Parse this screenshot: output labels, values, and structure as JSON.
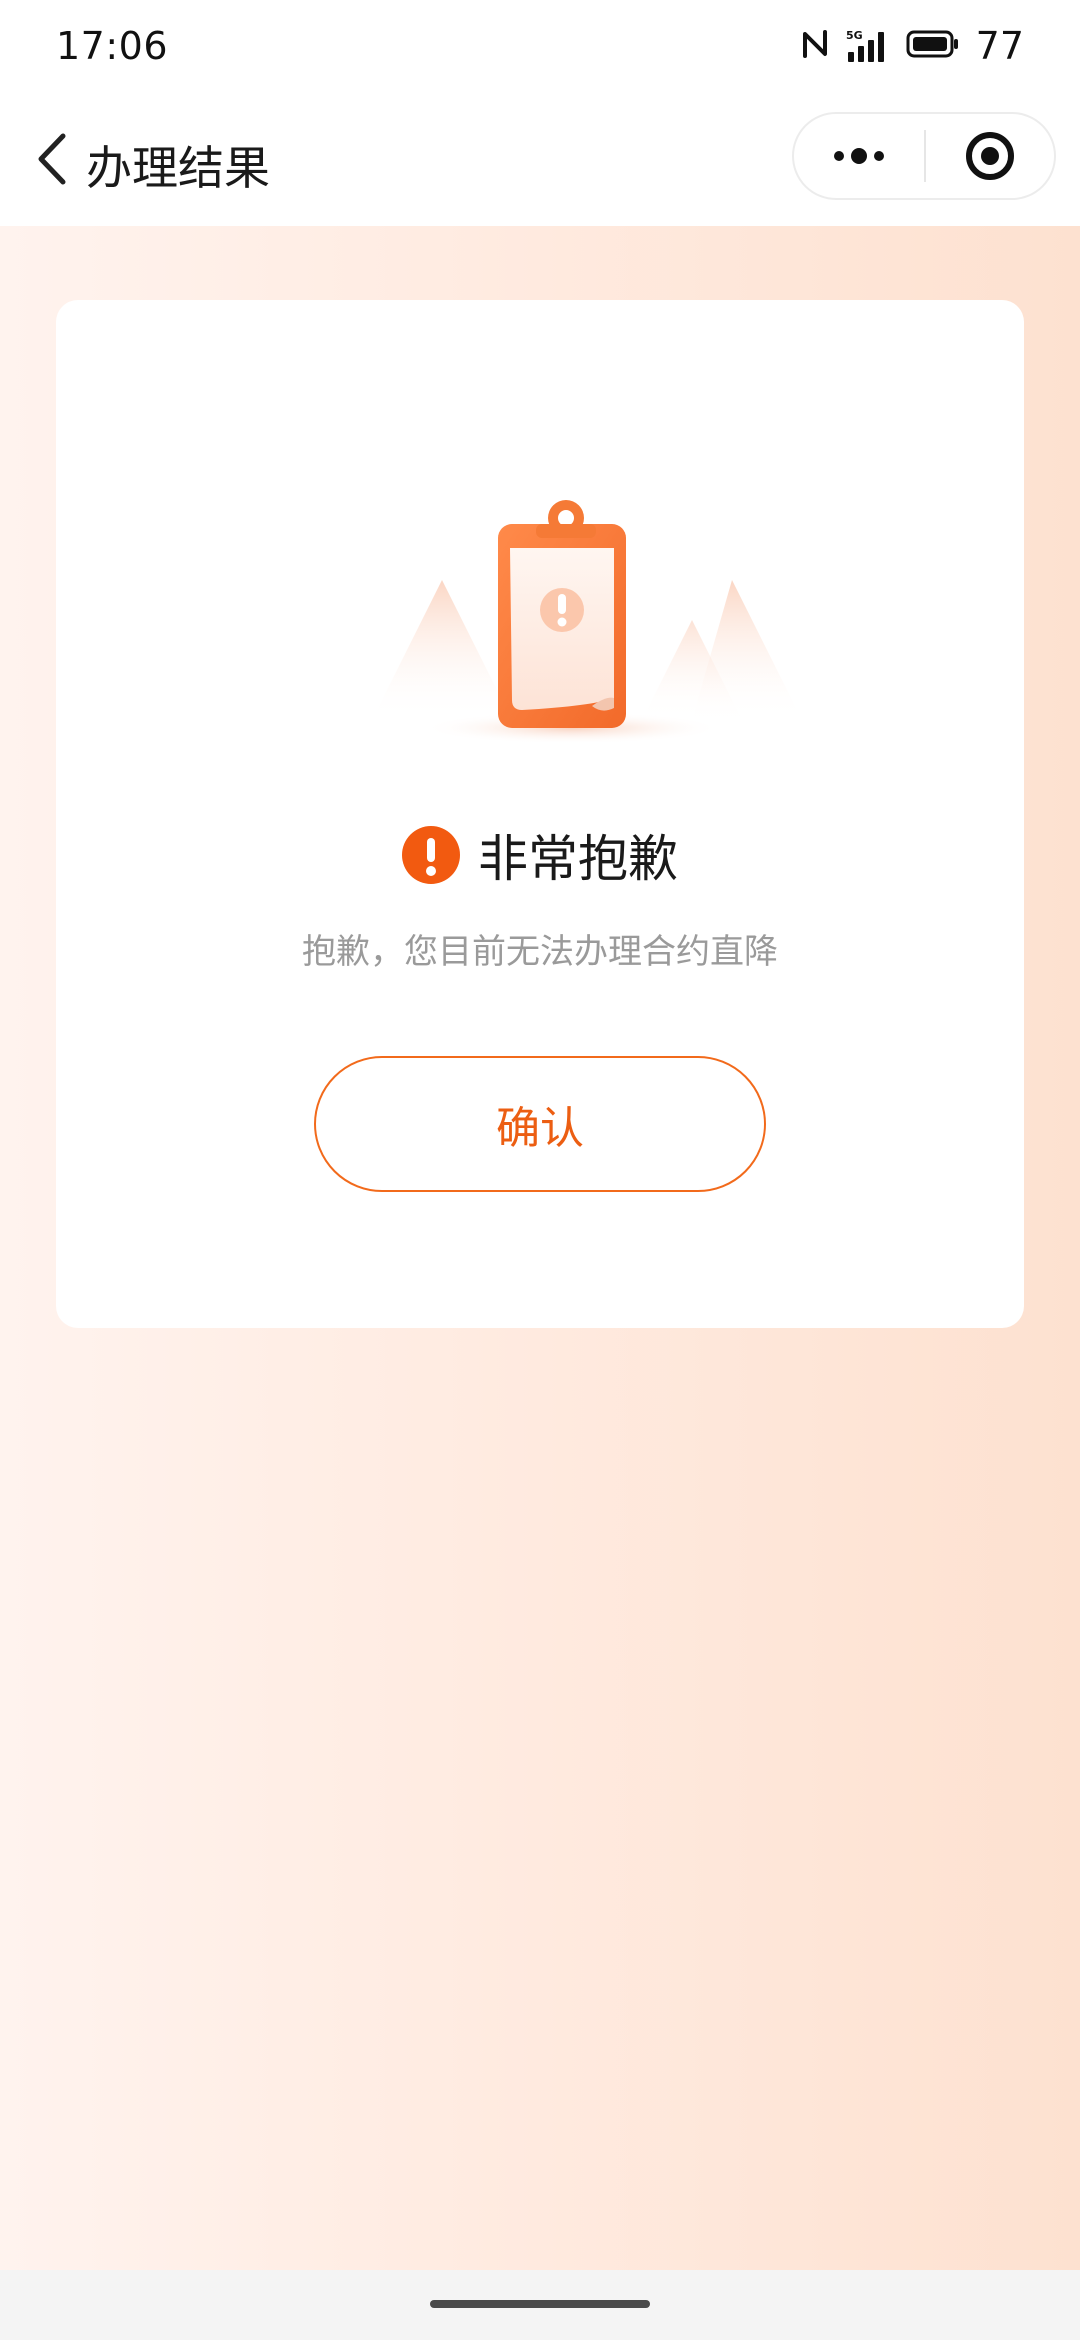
{
  "status_bar": {
    "time": "17:06",
    "network_badge": "5G",
    "battery": "77"
  },
  "nav": {
    "title": "办理结果",
    "icons": {
      "back": "chevron-left-icon",
      "more": "more-dots-icon",
      "close": "target-circle-icon"
    }
  },
  "result": {
    "headline": "非常抱歉",
    "message": "抱歉，您目前无法办理合约直降",
    "confirm_label": "确认",
    "illustration_mark": "!"
  },
  "colors": {
    "accent": "#f25a10",
    "button_text": "#ec5e12",
    "background_left": "#fff3ee",
    "background_right": "#fde1d0"
  }
}
